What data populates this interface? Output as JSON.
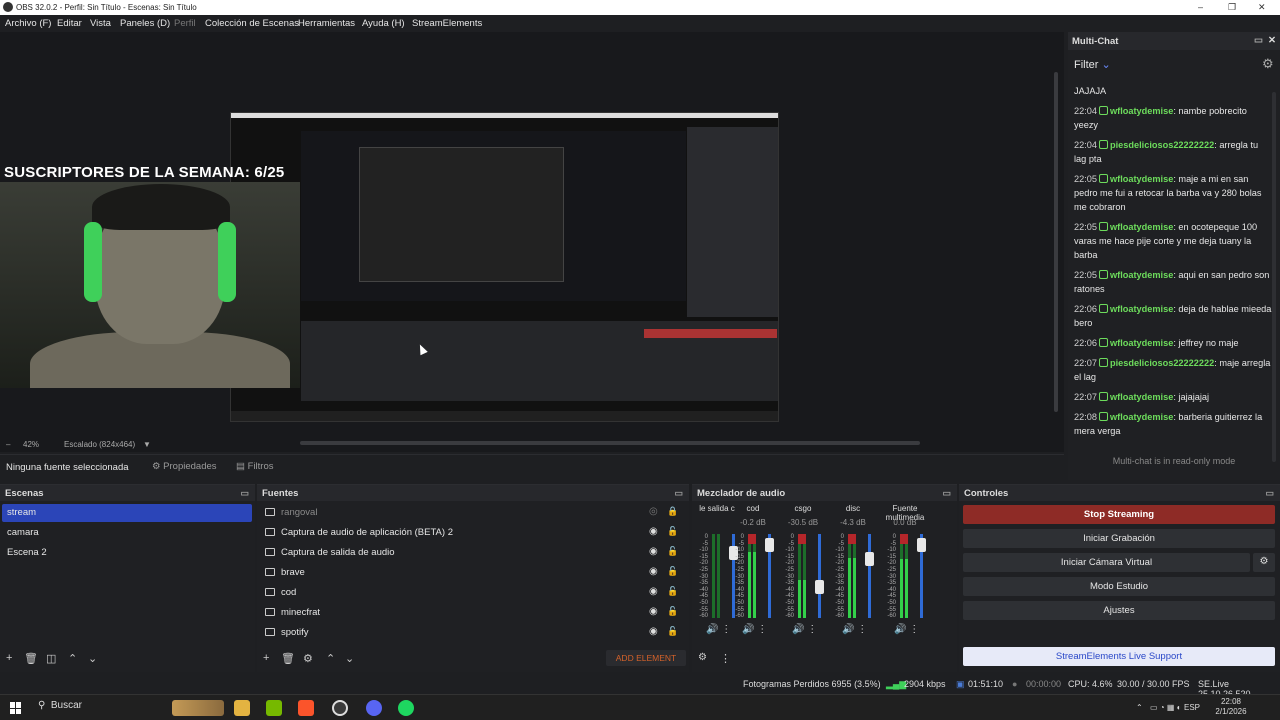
{
  "window": {
    "title": "OBS 32.0.2 - Perfil: Sin Título - Escenas: Sin Título",
    "minimize": "–",
    "restore": "❐",
    "close": "✕"
  },
  "menu": [
    "Archivo (F)",
    "Editar",
    "Vista",
    "Paneles (D)",
    "Perfil",
    "Colección de Escenas",
    "Herramientas",
    "Ayuda (H)",
    "StreamElements"
  ],
  "preview": {
    "overlay_text": "SUSCRIPTORES DE LA SEMANA: 6/25",
    "zoom": "42%",
    "scale": "Escalado (824x464)"
  },
  "source_bar": {
    "no_source": "Ninguna fuente seleccionada",
    "properties": "Propiedades",
    "filters": "Filtros"
  },
  "multichat": {
    "title": "Multi-Chat",
    "filter": "Filter",
    "first_line": "JAJAJA",
    "messages": [
      {
        "time": "22:04",
        "user": "wfloatydemise",
        "text": "nambe pobrecito yeezy"
      },
      {
        "time": "22:04",
        "user": "piesdeliciosos22222222",
        "text": "arregla tu lag pta"
      },
      {
        "time": "22:05",
        "user": "wfloatydemise",
        "text": "maje a mi en san pedro me fui a retocar la barba va y 280 bolas me cobraron"
      },
      {
        "time": "22:05",
        "user": "wfloatydemise",
        "text": "en ocotepeque 100 varas me hace pije corte y me deja tuany la barba"
      },
      {
        "time": "22:05",
        "user": "wfloatydemise",
        "text": "aqui en san pedro son ratones"
      },
      {
        "time": "22:06",
        "user": "wfloatydemise",
        "text": "deja de hablae mieeda bero"
      },
      {
        "time": "22:06",
        "user": "wfloatydemise",
        "text": "jeffrey no maje"
      },
      {
        "time": "22:07",
        "user": "piesdeliciosos22222222",
        "text": "maje arregla el lag"
      },
      {
        "time": "22:07",
        "user": "wfloatydemise",
        "text": "jajajajaj"
      },
      {
        "time": "22:08",
        "user": "wfloatydemise",
        "text": "barberia guitierrez la mera verga"
      }
    ],
    "readonly": "Multi-chat is in read-only mode"
  },
  "scenes": {
    "title": "Escenas",
    "items": [
      "stream",
      "camara",
      "Escena 2"
    ]
  },
  "sources": {
    "title": "Fuentes",
    "items": [
      "rangoval",
      "Captura de audio de aplicación (BETA) 2",
      "Captura de salida de audio",
      "brave",
      "cod",
      "minecfrat",
      "spotify"
    ],
    "add_element": "ADD ELEMENT"
  },
  "mixer": {
    "title": "Mezclador de audio",
    "scale": [
      "0",
      "-5",
      "-10",
      "-15",
      "-20",
      "-25",
      "-30",
      "-35",
      "-40",
      "-45",
      "-50",
      "-55",
      "-60"
    ],
    "channels": [
      {
        "name": "le salida c",
        "db": ""
      },
      {
        "name": "cod",
        "db": "-0.2 dB"
      },
      {
        "name": "csgo",
        "db": "-30.5 dB"
      },
      {
        "name": "disc",
        "db": "-4.3 dB"
      },
      {
        "name": "Fuente multimedia",
        "db": "0.0 dB"
      }
    ]
  },
  "controls": {
    "title": "Controles",
    "stop": "Stop Streaming",
    "record": "Iniciar Grabación",
    "vcam": "Iniciar Cámara Virtual",
    "studio": "Modo Estudio",
    "settings": "Ajustes",
    "se_support": "StreamElements Live Support"
  },
  "status": {
    "dropped": "Fotogramas Perdidos 6955 (3.5%)",
    "bitrate": "2904 kbps",
    "live_time": "01:51:10",
    "rec_time": "00:00:00",
    "cpu": "CPU: 4.6%",
    "fps": "30.00 / 30.00 FPS",
    "se_version": "SE.Live 25.10.26.520"
  },
  "taskbar": {
    "search": "Buscar",
    "lang": "ESP",
    "time": "22:08",
    "date": "2/1/2026"
  },
  "colors": {
    "accent": "#2b45b8",
    "stop": "#8e2b26",
    "chat_user": "#6ddc5c"
  }
}
